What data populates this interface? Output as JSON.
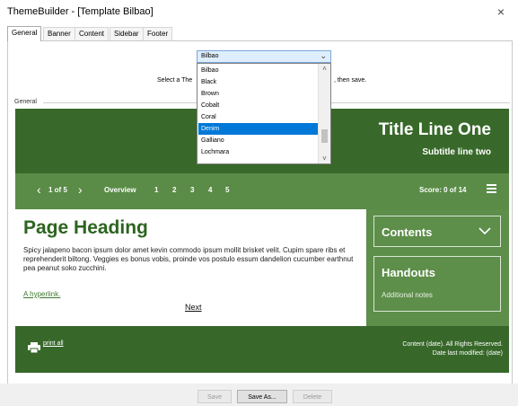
{
  "window": {
    "title": "ThemeBuilder - [Template Bilbao]",
    "close": "×"
  },
  "tabs": [
    {
      "label": "General",
      "active": true
    },
    {
      "label": "Banner",
      "active": false
    },
    {
      "label": "Content",
      "active": false
    },
    {
      "label": "Sidebar",
      "active": false
    },
    {
      "label": "Footer",
      "active": false
    }
  ],
  "instruction": {
    "left": "Select a The",
    "right": ", then save."
  },
  "group": {
    "label": "General"
  },
  "template_select": {
    "value": "Bilbao",
    "options": [
      "Bilbao",
      "Black",
      "Brown",
      "Cobalt",
      "Coral",
      "Denim",
      "Galliano",
      "Lochmara"
    ],
    "highlighted": "Denim"
  },
  "preview": {
    "banner": {
      "title": "Title Line One",
      "subtitle": "Subtitle line two"
    },
    "nav": {
      "prev": "‹",
      "next": "›",
      "count": "1 of 5",
      "overview": "Overview",
      "pages": [
        "1",
        "2",
        "3",
        "4",
        "5"
      ],
      "score": "Score: 0 of 14"
    },
    "content": {
      "heading": "Page Heading",
      "body": "Spicy jalapeno bacon ipsum dolor amet kevin commodo ipsum mollit brisket velit. Cupim spare ribs et reprehenderit biltong. Veggies es bonus vobis, proinde vos postulo essum dandelion cucumber earthnut pea peanut soko zucchini.",
      "hyperlink": "A hyperlink.",
      "next": "Next"
    },
    "sidebar": {
      "contents_title": "Contents",
      "handouts_title": "Handouts",
      "handouts_note": "Additional notes"
    },
    "footer": {
      "print": "print all",
      "line1": "Content (date). All Rights Reserved.",
      "line2": "Date last modified: (date)"
    }
  },
  "buttons": {
    "save": "Save",
    "save_as": "Save As...",
    "delete": "Delete"
  },
  "colors": {
    "banner": "#38692a",
    "nav": "#5a8c48",
    "heading": "#2d6420",
    "selection": "#0078d7"
  }
}
